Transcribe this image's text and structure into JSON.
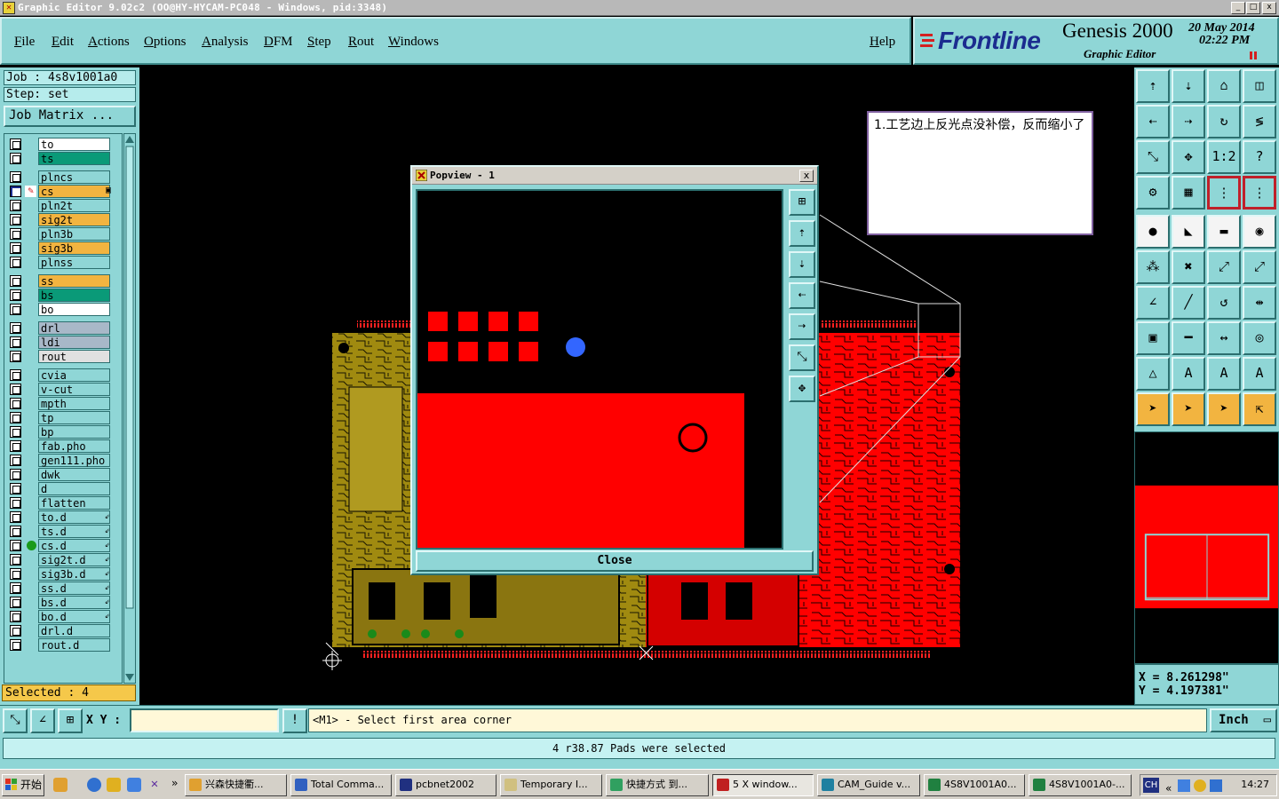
{
  "window": {
    "title": "Graphic Editor 9.02c2  (OO@HY-HYCAM-PC048 - Windows, pid:3348)",
    "controls": [
      "_",
      "□",
      "x"
    ]
  },
  "menu": {
    "items": [
      "File",
      "Edit",
      "Actions",
      "Options",
      "Analysis",
      "DFM",
      "Step",
      "Rout",
      "Windows"
    ],
    "help": "Help"
  },
  "brand": {
    "logo": "Frontline",
    "name": "Genesis 2000",
    "sub": "Graphic Editor",
    "date": "20 May 2014",
    "time": "02:22 PM"
  },
  "left": {
    "job": "Job : 4s8v1001a0",
    "step": "Step:  set",
    "job_matrix": "Job Matrix ...",
    "selected": "Selected : 4",
    "layers": [
      {
        "name": "to",
        "color": "#ffffff",
        "mark": ""
      },
      {
        "name": "ts",
        "color": "#0a9a78",
        "mark": ""
      },
      {
        "name": "plncs",
        "color": "#8fd6d6",
        "mark": ""
      },
      {
        "name": "cs",
        "color": "#f2b440",
        "mark": "▣",
        "active": true
      },
      {
        "name": "pln2t",
        "color": "#8fd6d6",
        "mark": ""
      },
      {
        "name": "sig2t",
        "color": "#f2b440",
        "mark": ""
      },
      {
        "name": "pln3b",
        "color": "#8fd6d6",
        "mark": ""
      },
      {
        "name": "sig3b",
        "color": "#f2b440",
        "mark": ""
      },
      {
        "name": "plnss",
        "color": "#8fd6d6",
        "mark": ""
      },
      {
        "name": "ss",
        "color": "#f2b440",
        "mark": ""
      },
      {
        "name": "bs",
        "color": "#0a9a78",
        "mark": ""
      },
      {
        "name": "bo",
        "color": "#ffffff",
        "mark": ""
      },
      {
        "name": "drl",
        "color": "#a8b8c8",
        "mark": ""
      },
      {
        "name": "ldi",
        "color": "#a8b8c8",
        "mark": ""
      },
      {
        "name": "rout",
        "color": "#e0e0e0",
        "mark": ""
      },
      {
        "name": "cvia",
        "color": "#8fd6d6",
        "mark": ""
      },
      {
        "name": "v-cut",
        "color": "#8fd6d6",
        "mark": ""
      },
      {
        "name": "mpth",
        "color": "#8fd6d6",
        "mark": ""
      },
      {
        "name": "tp",
        "color": "#8fd6d6",
        "mark": ""
      },
      {
        "name": "bp",
        "color": "#8fd6d6",
        "mark": ""
      },
      {
        "name": "fab.pho",
        "color": "#8fd6d6",
        "mark": ""
      },
      {
        "name": "gen111.pho",
        "color": "#8fd6d6",
        "mark": ""
      },
      {
        "name": "dwk",
        "color": "#8fd6d6",
        "mark": ""
      },
      {
        "name": "d",
        "color": "#8fd6d6",
        "mark": ""
      },
      {
        "name": "flatten",
        "color": "#8fd6d6",
        "mark": ""
      },
      {
        "name": "to.d",
        "color": "#8fd6d6",
        "mark": "⇙"
      },
      {
        "name": "ts.d",
        "color": "#8fd6d6",
        "mark": "⇙"
      },
      {
        "name": "cs.d",
        "color": "#8fd6d6",
        "mark": "⇙",
        "dot": true
      },
      {
        "name": "sig2t.d",
        "color": "#8fd6d6",
        "mark": "⇙"
      },
      {
        "name": "sig3b.d",
        "color": "#8fd6d6",
        "mark": "⇙"
      },
      {
        "name": "ss.d",
        "color": "#8fd6d6",
        "mark": "⇙"
      },
      {
        "name": "bs.d",
        "color": "#8fd6d6",
        "mark": "⇙"
      },
      {
        "name": "bo.d",
        "color": "#8fd6d6",
        "mark": "⇙"
      },
      {
        "name": "drl.d",
        "color": "#8fd6d6",
        "mark": ""
      },
      {
        "name": "rout.d",
        "color": "#8fd6d6",
        "mark": ""
      }
    ]
  },
  "note": {
    "text": "1.工艺边上反光点没补偿，反而缩小了"
  },
  "popview": {
    "title": "Popview - 1",
    "close_label": "Close",
    "close_x": "x"
  },
  "coords": {
    "x": "X = 8.261298\"",
    "y": "Y = 4.197381\""
  },
  "command": {
    "xy_label": "X Y :",
    "xy_value": "",
    "bang": "!",
    "prompt": "<M1> - Select first area corner",
    "unit": "Inch"
  },
  "status": {
    "text": "4 r38.87 Pads were selected"
  },
  "taskbar": {
    "start": "开始",
    "tasks": [
      {
        "label": "兴森快捷衢...",
        "icon_color": "#e0a030"
      },
      {
        "label": "Total Comma...",
        "icon_color": "#3060c0"
      },
      {
        "label": "pcbnet2002",
        "icon_color": "#203080"
      },
      {
        "label": "Temporary I...",
        "icon_color": "#d0c080"
      },
      {
        "label": "快捷方式 到...",
        "icon_color": "#30a060"
      },
      {
        "label": "5 X window...",
        "icon_color": "#c02020",
        "pressed": true
      },
      {
        "label": "CAM_Guide v...",
        "icon_color": "#2080a0"
      },
      {
        "label": "4S8V1001A0...",
        "icon_color": "#208040"
      },
      {
        "label": "4S8V1001A0-...",
        "icon_color": "#208040"
      }
    ],
    "tray_lang": "CH",
    "clock": "14:27"
  },
  "colors": {
    "teal": "#8fd6d6",
    "copper_red": "#ff0000",
    "copper_gold": "#a08a10",
    "accent_orange": "#f2b440"
  }
}
